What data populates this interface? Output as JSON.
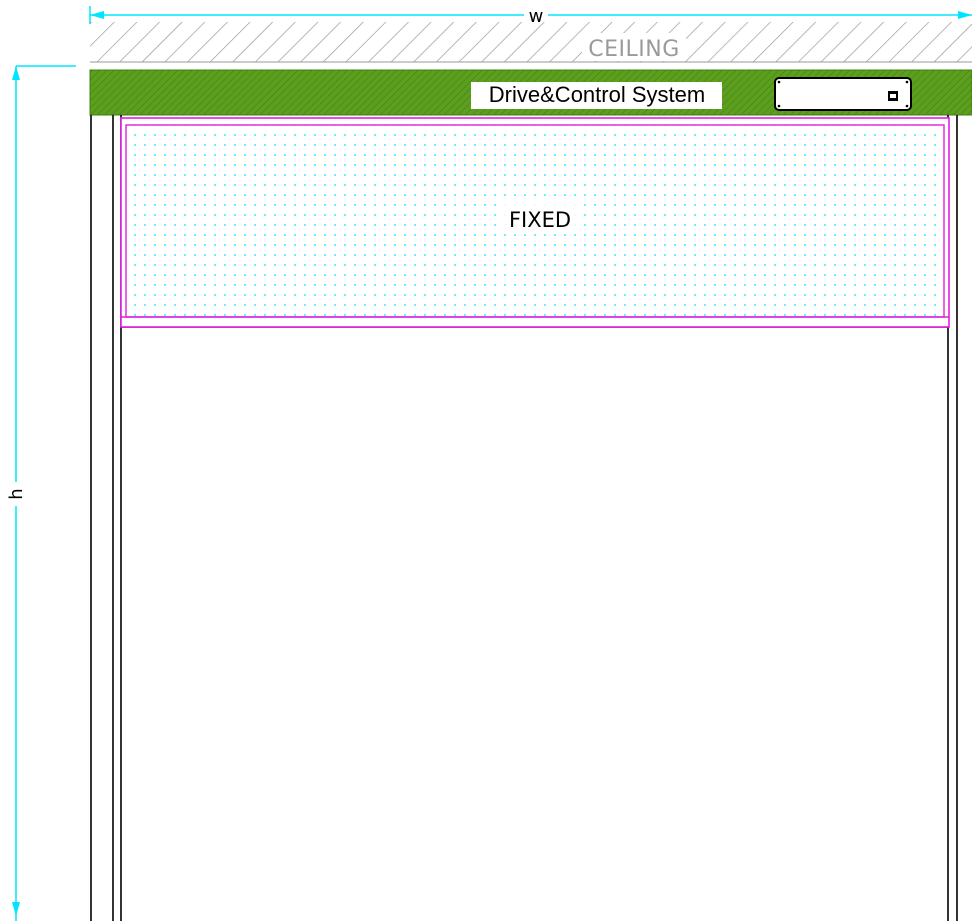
{
  "dimensions": {
    "width_label": "w",
    "height_label": "h"
  },
  "ceiling": {
    "label": "CEILING"
  },
  "header_beam": {
    "label": "Drive&Control System"
  },
  "panels": {
    "fixed_label": "FIXED"
  },
  "colors": {
    "dimension_lines": "#00e5ff",
    "ceiling_hatch": "#9a9a9a",
    "header_fill": "#5c9e1e",
    "fixed_panel_outline": "#e020e0",
    "fixed_panel_dots": "#00e5ff",
    "frame_lines": "#000000"
  },
  "icons": {
    "control_box": "control-box-icon",
    "plug": "plug-icon"
  }
}
